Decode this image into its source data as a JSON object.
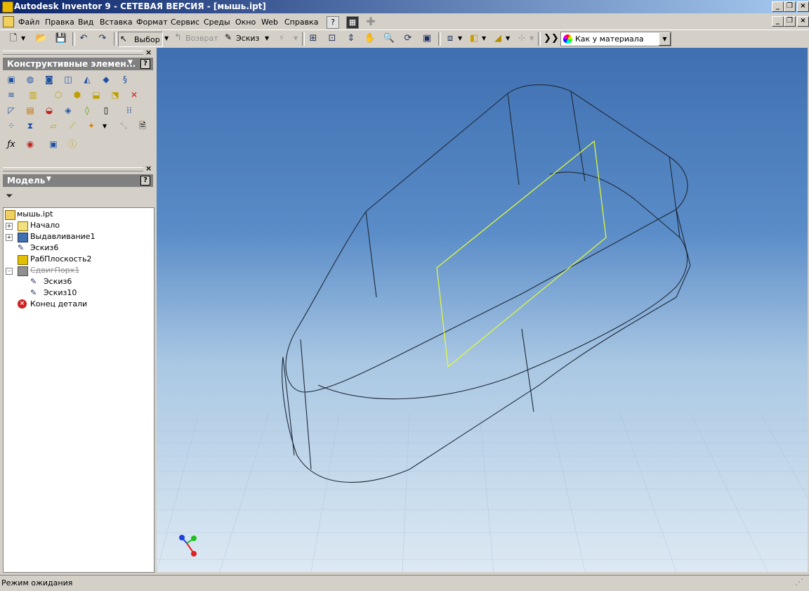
{
  "window": {
    "title": "Autodesk Inventor 9  - СЕТЕВАЯ ВЕРСИЯ - [мышь.ipt]",
    "min_glyph": "_",
    "max_glyph": "❐",
    "close_glyph": "×"
  },
  "menu": {
    "items": [
      "Файл",
      "Правка",
      "Вид",
      "Вставка",
      "Формат",
      "Сервис",
      "Среды",
      "Окно",
      "Web",
      "Справка"
    ]
  },
  "toolbar": {
    "select_label": "Выбор",
    "return_label": "Возврат",
    "sketch_label": "Эскиз",
    "material_value": "Как у материала"
  },
  "features_panel": {
    "title": "Конструктивные элемен...",
    "help": "?"
  },
  "model_panel": {
    "title": "Модель",
    "help": "?",
    "tree": [
      {
        "label": "мышь.ipt"
      },
      {
        "label": "Начало"
      },
      {
        "label": "Выдавливание1"
      },
      {
        "label": "Эскиз6"
      },
      {
        "label": "РабПлоскость2"
      },
      {
        "label": "СдвигПорх1"
      },
      {
        "label": "Эскиз6"
      },
      {
        "label": "Эскиз10"
      },
      {
        "label": "Конец детали"
      }
    ]
  },
  "status": {
    "text": "Режим ожидания"
  },
  "colors": {
    "title_start": "#0a246a",
    "title_end": "#a6caf0",
    "viewport_top": "#3f6fb0",
    "viewport_bottom": "#dde9f3",
    "workplane": "#e6ff30",
    "axis_x": "#e02020",
    "axis_y": "#20c020",
    "axis_z": "#2040e0"
  }
}
